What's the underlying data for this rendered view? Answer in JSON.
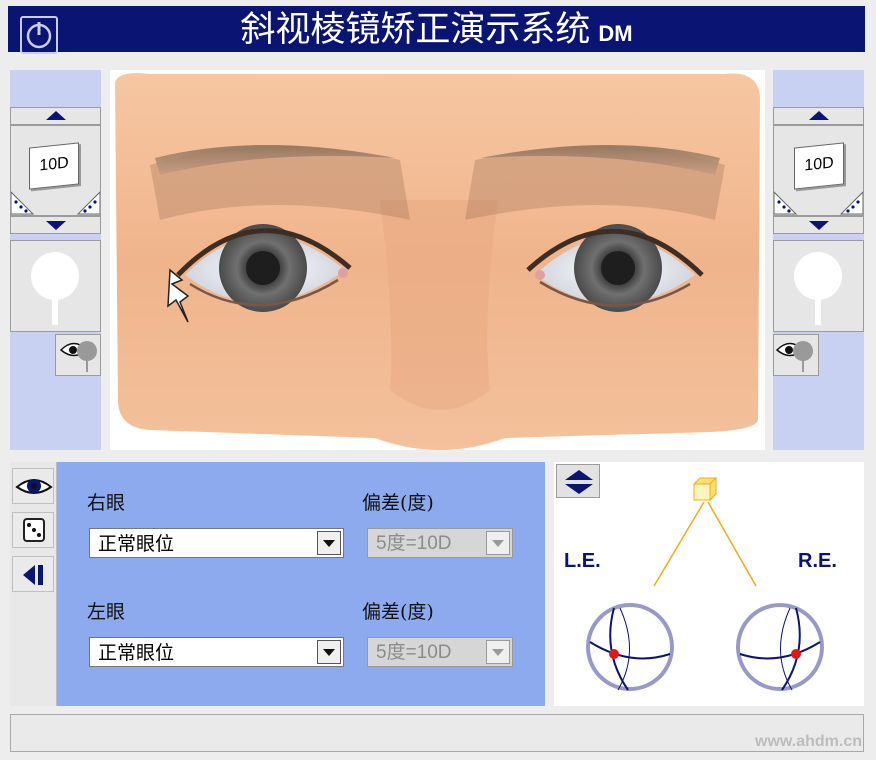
{
  "app": {
    "title": "斜视棱镜矫正演示系统",
    "title_suffix": "DM",
    "watermark": "www.ahdm.cn"
  },
  "colors": {
    "accent": "#0a1473",
    "panel_bg": "#c9d1f2",
    "controls_bg": "#8eaaef",
    "diagram_line": "#f4a91a",
    "marker": "#dd1a1a"
  },
  "left_panel": {
    "prism_label": "10D",
    "icons": [
      "arrow-up-icon",
      "prism-card-icon",
      "arrow-down-icon",
      "fixation-target-icon",
      "eye-occluder-icon"
    ]
  },
  "right_panel": {
    "prism_label": "10D",
    "icons": [
      "arrow-up-icon",
      "prism-card-icon",
      "arrow-down-icon",
      "fixation-target-icon",
      "eye-occluder-icon"
    ]
  },
  "tools": {
    "icons": [
      "eye-icon",
      "dice-icon",
      "step-back-icon"
    ]
  },
  "right_eye": {
    "label": "右眼",
    "position_value": "正常眼位",
    "deviation_label": "偏差(度)",
    "deviation_value": "5度=10D"
  },
  "left_eye": {
    "label": "左眼",
    "position_value": "正常眼位",
    "deviation_label": "偏差(度)",
    "deviation_value": "5度=10D"
  },
  "diagram": {
    "le_label": "L.E.",
    "re_label": "R.E.",
    "toggle_icon": "up-down-toggle-icon"
  }
}
